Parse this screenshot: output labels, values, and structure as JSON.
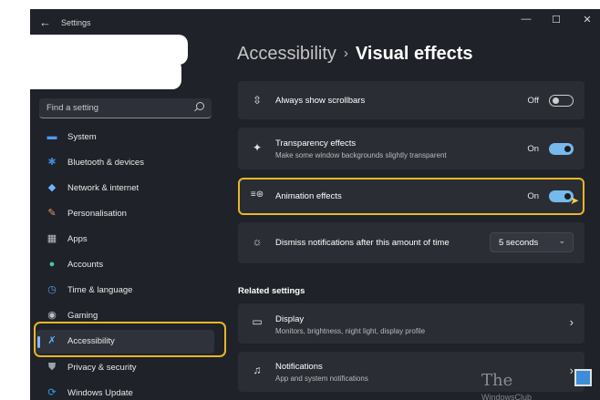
{
  "window": {
    "title": "Settings",
    "back_glyph": "←",
    "minimize_glyph": "—",
    "maximize_glyph": "☐",
    "close_glyph": "✕"
  },
  "search": {
    "placeholder": "Find a setting",
    "icon": "search-icon"
  },
  "sidebar": {
    "items": [
      {
        "label": "System",
        "icon": "monitor-icon",
        "color": "#4a9cf5",
        "glyph": "▬"
      },
      {
        "label": "Bluetooth & devices",
        "icon": "bluetooth-icon",
        "color": "#3b87e0",
        "glyph": "✱"
      },
      {
        "label": "Network & internet",
        "icon": "wifi-icon",
        "color": "#6cb6ff",
        "glyph": "◆"
      },
      {
        "label": "Personalisation",
        "icon": "brush-icon",
        "color": "#e0a060",
        "glyph": "✎"
      },
      {
        "label": "Apps",
        "icon": "apps-icon",
        "color": "#b9c0cc",
        "glyph": "▦"
      },
      {
        "label": "Accounts",
        "icon": "person-icon",
        "color": "#4fc3a1",
        "glyph": "●"
      },
      {
        "label": "Time & language",
        "icon": "globe-clock-icon",
        "color": "#5aa0e8",
        "glyph": "◷"
      },
      {
        "label": "Gaming",
        "icon": "gamepad-icon",
        "color": "#b9c0cc",
        "glyph": "◉"
      },
      {
        "label": "Accessibility",
        "icon": "accessibility-icon",
        "color": "#5ab0ff",
        "glyph": "✗",
        "selected": true
      },
      {
        "label": "Privacy & security",
        "icon": "shield-icon",
        "color": "#9aa3b0",
        "glyph": "⛊"
      },
      {
        "label": "Windows Update",
        "icon": "update-icon",
        "color": "#3b9cf0",
        "glyph": "⟳"
      }
    ]
  },
  "breadcrumb": {
    "parent": "Accessibility",
    "separator": "›",
    "current": "Visual effects"
  },
  "settings": {
    "scrollbars": {
      "title": "Always show scrollbars",
      "state": "Off",
      "icon": "scrollbar-icon",
      "glyph": "⇳"
    },
    "transparency": {
      "title": "Transparency effects",
      "subtitle": "Make some window backgrounds slightly transparent",
      "state": "On",
      "icon": "transparency-icon",
      "glyph": "✦"
    },
    "animation": {
      "title": "Animation effects",
      "state": "On",
      "icon": "animation-icon",
      "glyph": "≡⊛"
    },
    "notifications": {
      "title": "Dismiss notifications after this amount of time",
      "value": "5 seconds",
      "icon": "sun-icon",
      "glyph": "☼",
      "chevron": "⌄"
    }
  },
  "related": {
    "heading": "Related settings",
    "items": [
      {
        "title": "Display",
        "subtitle": "Monitors, brightness, night light, display profile",
        "icon": "display-icon",
        "glyph": "▭",
        "chevron": "›"
      },
      {
        "title": "Notifications",
        "subtitle": "App and system notifications",
        "icon": "bell-icon",
        "glyph": "♫",
        "chevron": "›"
      }
    ]
  },
  "watermark": {
    "text": "The",
    "url": "WindowsClub"
  },
  "colors": {
    "accent": "#76b9ed",
    "highlight": "#e8b726",
    "background": "#1f2228",
    "card": "#2a2d34"
  }
}
